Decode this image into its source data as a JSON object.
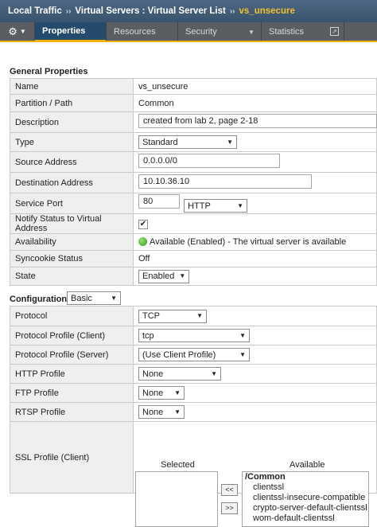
{
  "breadcrumb": {
    "part1": "Local Traffic",
    "part2": "Virtual Servers : Virtual Server List",
    "current": "vs_unsecure",
    "sep": "››"
  },
  "tabs": [
    {
      "label": "Properties"
    },
    {
      "label": "Resources"
    },
    {
      "label": "Security"
    },
    {
      "label": "Statistics"
    }
  ],
  "general": {
    "title": "General Properties",
    "name_label": "Name",
    "name_value": "vs_unsecure",
    "partition_label": "Partition / Path",
    "partition_value": "Common",
    "description_label": "Description",
    "description_value": "created from lab 2, page 2-18",
    "type_label": "Type",
    "type_value": "Standard",
    "source_label": "Source Address",
    "source_value": "0.0.0.0/0",
    "dest_label": "Destination Address",
    "dest_value": "10.10.36.10",
    "port_label": "Service Port",
    "port_value": "80",
    "port_service": "HTTP",
    "notify_label": "Notify Status to Virtual Address",
    "availability_label": "Availability",
    "availability_value": "Available (Enabled) - The virtual server is available",
    "syncookie_label": "Syncookie Status",
    "syncookie_value": "Off",
    "state_label": "State",
    "state_value": "Enabled"
  },
  "configuration": {
    "title": "Configuration:",
    "mode": "Basic",
    "protocol_label": "Protocol",
    "protocol_value": "TCP",
    "client_profile_label": "Protocol Profile (Client)",
    "client_profile_value": "tcp",
    "server_profile_label": "Protocol Profile (Server)",
    "server_profile_value": "(Use Client Profile)",
    "http_label": "HTTP Profile",
    "http_value": "None",
    "ftp_label": "FTP Profile",
    "ftp_value": "None",
    "rtsp_label": "RTSP Profile",
    "rtsp_value": "None",
    "ssl_label": "SSL Profile (Client)",
    "selected_header": "Selected",
    "available_header": "Available",
    "move_left": "<<",
    "move_right": ">>",
    "available": [
      "/Common",
      "clientssl",
      "clientssl-insecure-compatible",
      "crypto-server-default-clientssl",
      "wom-default-clientssl"
    ]
  },
  "colors": {
    "accent": "#f0b400",
    "breadcrumb_current": "#f3c12f",
    "available_green": "#2e9a12"
  }
}
